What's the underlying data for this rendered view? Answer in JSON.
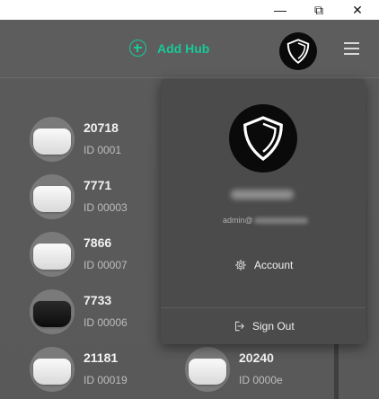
{
  "window": {
    "minimize": "—",
    "restore": "⧉",
    "close": "✕"
  },
  "header": {
    "add_hub_label": "Add Hub"
  },
  "hubs": [
    {
      "name": "20718",
      "id": "ID 0001",
      "variant": "white"
    },
    {
      "name": "7771",
      "id": "ID 00003",
      "variant": "white"
    },
    {
      "name": "7866",
      "id": "ID 00007",
      "variant": "white"
    },
    {
      "name": "7733",
      "id": "ID 00006",
      "variant": "black"
    },
    {
      "name": "21181",
      "id": "ID 00019",
      "variant": "white"
    },
    {
      "name": "20240",
      "id": "ID 0000e",
      "variant": "white"
    }
  ],
  "account_menu": {
    "email_prefix": "admin@",
    "account_label": "Account",
    "signout_label": "Sign Out"
  },
  "colors": {
    "accent": "#19c99a",
    "background": "#5a5a5a",
    "popup": "#4b4b4b"
  }
}
